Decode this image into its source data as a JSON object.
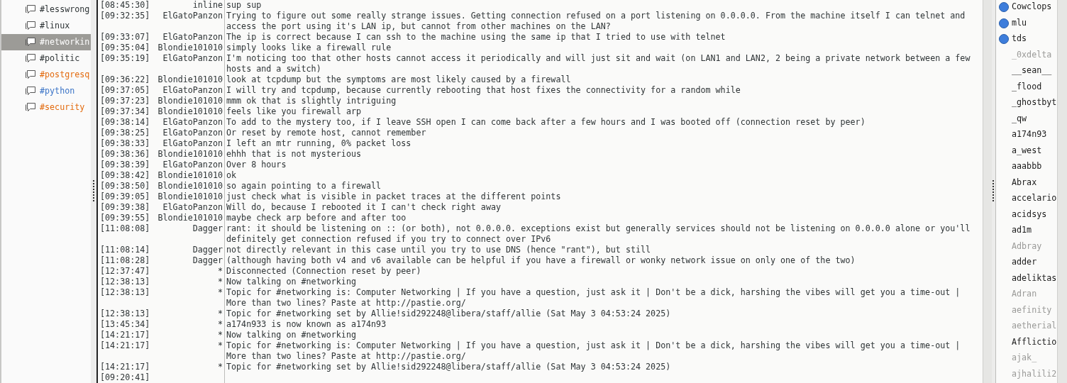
{
  "channels": [
    {
      "name": "#lesswrong",
      "selected": false,
      "color": "#2e3436"
    },
    {
      "name": "#linux",
      "selected": false,
      "color": "#2e3436"
    },
    {
      "name": "#networkin",
      "selected": true
    },
    {
      "name": "#politic",
      "selected": false,
      "color": "#2e3436"
    },
    {
      "name": "#postgresq",
      "selected": false,
      "color": "#e36b0f"
    },
    {
      "name": "#python",
      "selected": false,
      "color": "#3b74c7"
    },
    {
      "name": "#security",
      "selected": false,
      "color": "#e36b0f"
    }
  ],
  "messages": [
    {
      "time": "[08:45:30]",
      "nick": "inline",
      "text": "sup sup"
    },
    {
      "time": "[09:32:35]",
      "nick": "ElGatoPanzon",
      "text": "Trying to figure out some really strange issues. Getting connection refused on a port listening on 0.0.0.0. From the machine itself I can telnet and access the port using it's LAN ip, but cannot from other machines on the LAN?"
    },
    {
      "time": "[09:33:07]",
      "nick": "ElGatoPanzon",
      "text": "The ip is correct because I can ssh to the machine using the same ip that I tried to use with telnet"
    },
    {
      "time": "[09:35:04]",
      "nick": "Blondie101010",
      "text": "simply looks like a firewall rule"
    },
    {
      "time": "[09:35:19]",
      "nick": "ElGatoPanzon",
      "text": "I'm noticing too that other hosts cannot access it periodically and will just sit and wait (on LAN1 and LAN2, 2 being a private network between a few hosts and a switch)"
    },
    {
      "time": "[09:36:22]",
      "nick": "Blondie101010",
      "text": "look at tcpdump but the symptoms are most likely caused by a firewall"
    },
    {
      "time": "[09:37:05]",
      "nick": "ElGatoPanzon",
      "text": "I will try and tcpdump, because currently rebooting that host fixes the connectivity for a random while"
    },
    {
      "time": "[09:37:23]",
      "nick": "Blondie101010",
      "text": "mmm ok that is slightly intriguing"
    },
    {
      "time": "[09:37:34]",
      "nick": "Blondie101010",
      "text": "feels like you firewall arp"
    },
    {
      "time": "[09:38:14]",
      "nick": "ElGatoPanzon",
      "text": "To add to the mystery too, if I leave SSH open I can come back after a few hours and I was booted off (connection reset by peer)"
    },
    {
      "time": "[09:38:25]",
      "nick": "ElGatoPanzon",
      "text": "Or reset by remote host, cannot remember"
    },
    {
      "time": "[09:38:33]",
      "nick": "ElGatoPanzon",
      "text": "I left an mtr running, 0% packet loss"
    },
    {
      "time": "[09:38:36]",
      "nick": "Blondie101010",
      "text": "ehhh that is not mysterious"
    },
    {
      "time": "[09:38:39]",
      "nick": "ElGatoPanzon",
      "text": "Over 8 hours"
    },
    {
      "time": "[09:38:42]",
      "nick": "Blondie101010",
      "text": "ok"
    },
    {
      "time": "[09:38:50]",
      "nick": "Blondie101010",
      "text": "so again pointing to a firewall"
    },
    {
      "time": "[09:39:05]",
      "nick": "Blondie101010",
      "text": "just check what is visible in packet traces at the different points"
    },
    {
      "time": "[09:39:38]",
      "nick": "ElGatoPanzon",
      "text": "Will do, because I rebooted it I can't check right away"
    },
    {
      "time": "[09:39:55]",
      "nick": "Blondie101010",
      "text": "maybe check arp before and after too"
    },
    {
      "time": "[11:08:08]",
      "nick": "Dagger",
      "text": "rant: it should be listening on :: (or both), not 0.0.0.0. exceptions exist but generally services should not be listening on 0.0.0.0 alone or you'll definitely get connection refused if you try to connect over IPv6"
    },
    {
      "time": "[11:08:14]",
      "nick": "Dagger",
      "text": "not directly relevant in this case until you try to use DNS (hence \"rant\"), but still"
    },
    {
      "time": "[11:08:28]",
      "nick": "Dagger",
      "text": "(although having both v4 and v6 available can be helpful if you have a firewall or wonky network issue on only one of the two)"
    },
    {
      "time": "[12:37:47]",
      "nick": "*",
      "text": "Disconnected (Connection reset by peer)"
    },
    {
      "time": "[12:38:13]",
      "nick": "*",
      "text": "Now talking on #networking"
    },
    {
      "time": "[12:38:13]",
      "nick": "*",
      "text": "Topic for #networking is: Computer Networking | If you have a question, just ask it | Don't be a dick, harshing the vibes will get you a time-out | More than two lines? Paste at http://pastie.org/"
    },
    {
      "time": "[12:38:13]",
      "nick": "*",
      "text": "Topic for #networking set by Allie!sid292248@libera/staff/allie (Sat May  3 04:53:24 2025)"
    },
    {
      "time": "[13:45:34]",
      "nick": "*",
      "text": "a174n933 is now known as a174n93"
    },
    {
      "time": "[14:21:17]",
      "nick": "*",
      "text": "Now talking on #networking"
    },
    {
      "time": "[14:21:17]",
      "nick": "*",
      "text": "Topic for #networking is: Computer Networking | If you have a question, just ask it | Don't be a dick, harshing the vibes will get you a time-out | More than two lines? Paste at http://pastie.org/"
    },
    {
      "time": "[14:21:17]",
      "nick": "*",
      "text": "Topic for #networking set by Allie!sid292248@libera/staff/allie (Sat May  3 04:53:24 2025)"
    },
    {
      "time": "[09:20:41]"
    }
  ],
  "users": [
    {
      "name": "Cowclops",
      "voiced": true,
      "away": false
    },
    {
      "name": "mlu",
      "voiced": true,
      "away": false
    },
    {
      "name": "tds",
      "voiced": true,
      "away": false
    },
    {
      "name": "_0xdelta",
      "voiced": false,
      "away": true
    },
    {
      "name": "__sean__",
      "voiced": false,
      "away": false
    },
    {
      "name": "_flood",
      "voiced": false,
      "away": false
    },
    {
      "name": "_ghostbyt",
      "voiced": false,
      "away": false
    },
    {
      "name": "_qw",
      "voiced": false,
      "away": false
    },
    {
      "name": "a174n93",
      "voiced": false,
      "away": false
    },
    {
      "name": "a_west",
      "voiced": false,
      "away": false
    },
    {
      "name": "aaabbb",
      "voiced": false,
      "away": false
    },
    {
      "name": "Abrax",
      "voiced": false,
      "away": false
    },
    {
      "name": "accelario",
      "voiced": false,
      "away": false
    },
    {
      "name": "acidsys",
      "voiced": false,
      "away": false
    },
    {
      "name": "ad1m",
      "voiced": false,
      "away": false
    },
    {
      "name": "Adbray",
      "voiced": false,
      "away": true
    },
    {
      "name": "adder",
      "voiced": false,
      "away": false
    },
    {
      "name": "adeliktas",
      "voiced": false,
      "away": false
    },
    {
      "name": "Adran",
      "voiced": false,
      "away": true
    },
    {
      "name": "aefinity",
      "voiced": false,
      "away": true
    },
    {
      "name": "aetherial",
      "voiced": false,
      "away": true
    },
    {
      "name": "Afflictio",
      "voiced": false,
      "away": false
    },
    {
      "name": "ajak_",
      "voiced": false,
      "away": true
    },
    {
      "name": "ajhalili2",
      "voiced": false,
      "away": true
    }
  ]
}
